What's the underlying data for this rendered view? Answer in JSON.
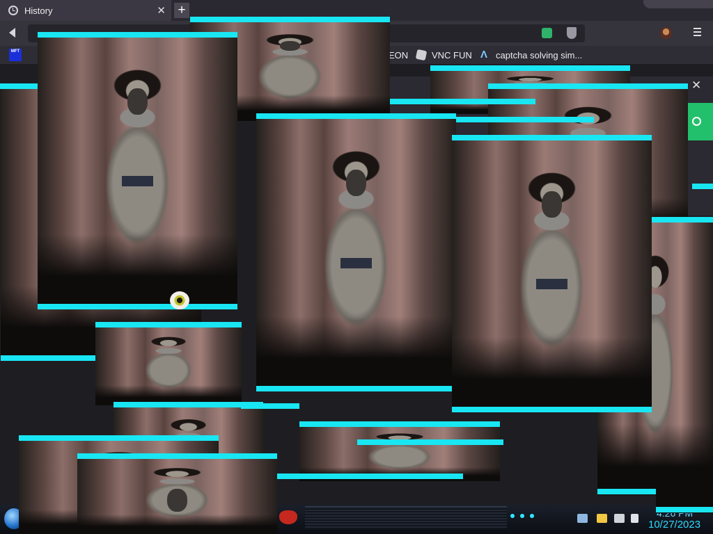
{
  "browser": {
    "tab": {
      "title": "History",
      "icon": "history-icon",
      "close_glyph": "✕"
    },
    "new_tab_glyph": "+",
    "bookmarks": [
      {
        "label": "MFT",
        "icon": "mft-icon"
      },
      {
        "label": "EON"
      },
      {
        "label": "VNC FUN",
        "icon": "vnc-icon"
      },
      {
        "label": "captcha solving sim...",
        "icon": "captcha-icon"
      }
    ],
    "panel_close_glyph": "✕"
  },
  "taskbar": {
    "clock_time": "4:26 PM",
    "clock_date": "10/27/2023",
    "tray_icons": [
      "network-icon",
      "action-center-flag-icon",
      "monitor-icon",
      "volume-icon"
    ]
  },
  "overlay": {
    "window_count": 14,
    "image_subject": "creepy-doll-photo",
    "accent_color": "#19e6f3"
  }
}
